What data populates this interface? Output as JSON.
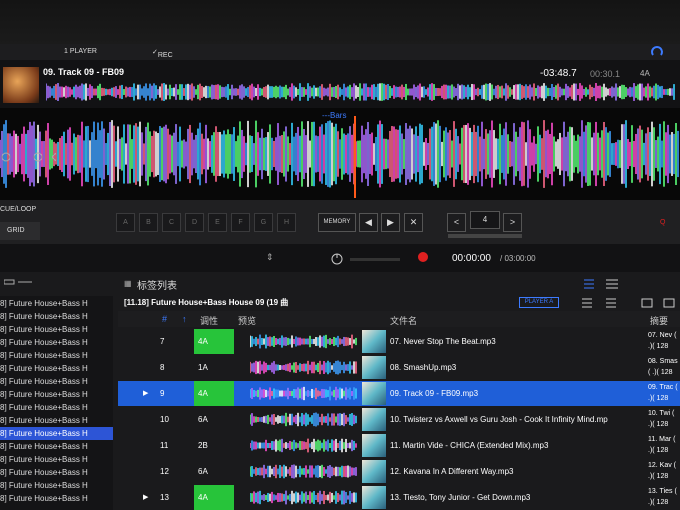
{
  "menu": {
    "player": "1 PLAYER",
    "rec": "REC"
  },
  "deck": {
    "title": "09. Track 09 - FB09",
    "remaining": "-03:48.7",
    "elapsed": "00:30.1",
    "key": "4A",
    "bars_label": "---Bars"
  },
  "cue": {
    "cue_loop": "CUE/LOOP",
    "grid": "GRID",
    "hot_cues": [
      "A",
      "B",
      "C",
      "D",
      "E",
      "F",
      "G",
      "H"
    ],
    "memory": "MEMORY",
    "prev": "◀",
    "next": "▶",
    "delete": "✕",
    "beat_value": "4",
    "beat_left": "<",
    "beat_right": ">",
    "cue_marker": "Q"
  },
  "transport": {
    "time": "00:00:00",
    "total": "/ 03:00:00"
  },
  "browser": {
    "tag_list": "标签列表",
    "folder": "[11.18] Future House+Bass House 09 (19 曲",
    "player": "PLAYER A"
  },
  "columns": {
    "num": "#",
    "key": "调性",
    "preview": "预览",
    "filename": "文件名",
    "summary": "摘要"
  },
  "sidebar": [
    "8] Future House+Bass H",
    "8] Future House+Bass H",
    "8] Future House+Bass H",
    "8] Future House+Bass H",
    "8] Future House+Bass H",
    "8] Future House+Bass H",
    "8] Future House+Bass H",
    "8] Future House+Bass H",
    "8] Future House+Bass H",
    "8] Future House+Bass H",
    "8] Future House+Bass H",
    "8] Future House+Bass H",
    "8] Future House+Bass H",
    "8] Future House+Bass H",
    "8] Future House+Bass H",
    "8] Future House+Bass H"
  ],
  "rows": [
    {
      "num": "7",
      "key": "4A",
      "file": "07. Never Stop The Beat.mp3",
      "sum": "07. Nev ( .)( 128"
    },
    {
      "num": "8",
      "key": "1A",
      "file": "08. SmashUp.mp3",
      "sum": "08. Smas ( .)( 128"
    },
    {
      "num": "9",
      "key": "4A",
      "file": "09. Track 09 - FB09.mp3",
      "sum": "09. Trac ( .)( 128"
    },
    {
      "num": "10",
      "key": "6A",
      "file": "10. Twisterz vs Axwell vs Guru Josh - Cook It Infinity Mind.mp",
      "sum": "10. Twi ( .)( 128"
    },
    {
      "num": "11",
      "key": "2B",
      "file": "11. Martin Vide - CHICA (Extended Mix).mp3",
      "sum": "11. Mar ( .)( 128"
    },
    {
      "num": "12",
      "key": "6A",
      "file": "12. Kavana In A Different Way.mp3",
      "sum": "12. Kav ( .)( 128"
    },
    {
      "num": "13",
      "key": "4A",
      "file": "13. Tiesto, Tony Junior - Get Down.mp3",
      "sum": "13. Ties ( .)( 128"
    }
  ],
  "colors": {
    "selected": "#1f5fd8",
    "key_green": "#27c43a",
    "accent_blue": "#3d7bff",
    "rec_red": "#e02020"
  }
}
